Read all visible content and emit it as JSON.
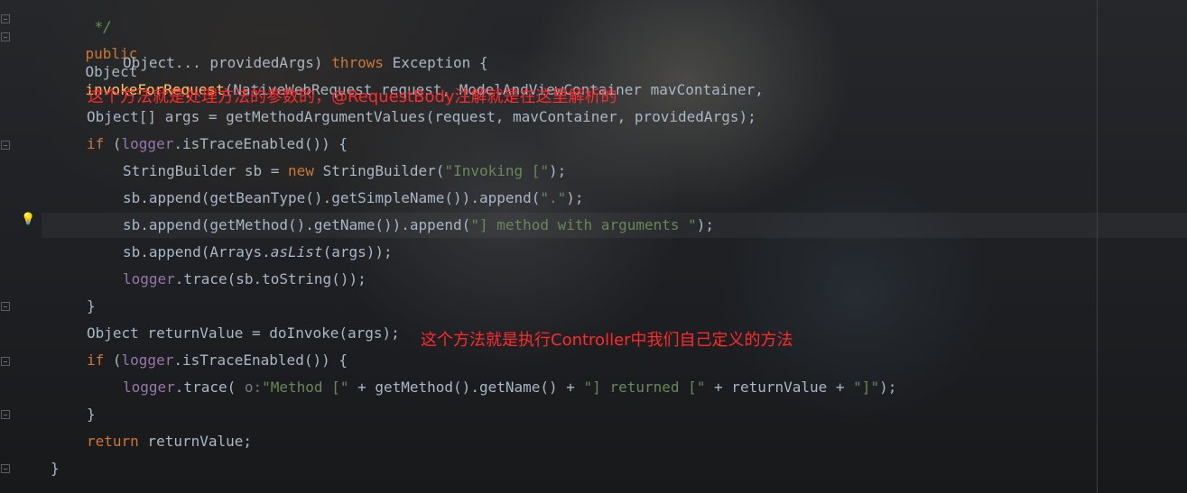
{
  "code": {
    "line1": {
      "comment": "*/"
    },
    "line2": {
      "kw_public": "public",
      "type_object": "Object",
      "method_name": "invokeForRequest",
      "params": "(NativeWebRequest request, ModelAndViewContainer mavContainer,"
    },
    "line3": {
      "text1": "Object... providedArgs) ",
      "kw_throws": "throws",
      "text2": " Exception {"
    },
    "line4": {
      "text": "Object[] args = getMethodArgumentValues(request, mavContainer, providedArgs);"
    },
    "line5": {
      "kw_if": "if",
      "p1": " (",
      "logger": "logger",
      "p2": ".isTraceEnabled()) {"
    },
    "line6": {
      "t1": "StringBuilder sb = ",
      "kw_new": "new",
      "t2": " StringBuilder(",
      "str": "\"Invoking [\"",
      "t3": ");"
    },
    "line7": {
      "t1": "sb.append(getBeanType().getSimpleName()).append(",
      "str": "\".\"",
      "t2": ");"
    },
    "line8": {
      "t1": "sb.append(getMethod().getName()).append(",
      "str": "\"] method with arguments \"",
      "t2": ");"
    },
    "line9": {
      "t1": "sb.append(Arrays.",
      "italic": "asList",
      "t2": "(args));"
    },
    "line10": {
      "logger": "logger",
      "t1": ".trace(sb.toString());"
    },
    "line11": {
      "text": "}"
    },
    "line12": {
      "text": "Object returnValue = doInvoke(args);"
    },
    "line13": {
      "kw_if": "if",
      "p1": " (",
      "logger": "logger",
      "p2": ".isTraceEnabled()) {"
    },
    "line14": {
      "logger": "logger",
      "t1": ".trace( ",
      "hint": "o:",
      "str1": "\"Method [\"",
      "t2": " + getMethod().getName() + ",
      "str2": "\"] returned [\"",
      "t3": " + returnValue + ",
      "str3": "\"]\"",
      "t4": ");"
    },
    "line15": {
      "text": "}"
    },
    "line16": {
      "kw_return": "return",
      "t1": " returnValue;"
    },
    "line17": {
      "text": "}"
    }
  },
  "annotations": {
    "top": "这个方法就是处理方法的参数的，@RequestBody注解就是在这里解析的",
    "bottom": "这个方法就是执行Controller中我们自己定义的方法"
  },
  "icons": {
    "gutter_hint": "lightbulb-icon"
  },
  "colors": {
    "keyword": "#cc7832",
    "method": "#ffc66d",
    "string": "#6a8759",
    "field": "#9876aa",
    "text": "#a9b7c6",
    "annotation": "#ff2b2b"
  }
}
